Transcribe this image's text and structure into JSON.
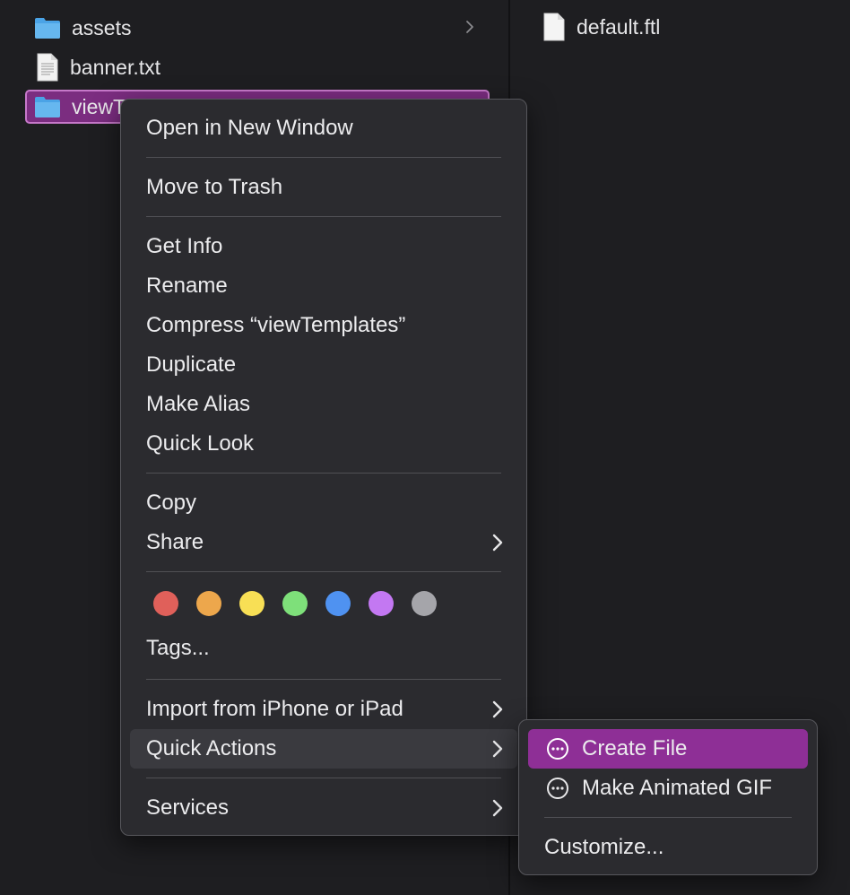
{
  "finder": {
    "left_items": [
      {
        "name": "assets",
        "kind": "folder-icon",
        "has_children": true
      },
      {
        "name": "banner.txt",
        "kind": "text-document-icon",
        "has_children": false
      },
      {
        "name": "viewT",
        "kind": "folder-icon",
        "has_children": true,
        "selected": true
      }
    ],
    "right_items": [
      {
        "name": "default.ftl",
        "kind": "document-icon"
      }
    ]
  },
  "context_menu": {
    "open_new_window": "Open in New Window",
    "move_to_trash": "Move to Trash",
    "get_info": "Get Info",
    "rename": "Rename",
    "compress": "Compress “viewTemplates”",
    "duplicate": "Duplicate",
    "make_alias": "Make Alias",
    "quick_look": "Quick Look",
    "copy": "Copy",
    "share": "Share",
    "tags": "Tags...",
    "import_iphone": "Import from iPhone or iPad",
    "quick_actions": "Quick Actions",
    "services": "Services",
    "tag_colors": {
      "red": "#e0605a",
      "orange": "#eda74c",
      "yellow": "#f8df55",
      "green": "#7ee07a",
      "blue": "#4f92f1",
      "purple": "#c378f2",
      "gray": "#a5a5aa"
    }
  },
  "quick_actions_submenu": {
    "create_file": "Create File",
    "make_gif": "Make Animated GIF",
    "customize": "Customize..."
  },
  "colors": {
    "selection": "#7b2d80",
    "submenu_highlight": "#8e2f96"
  }
}
